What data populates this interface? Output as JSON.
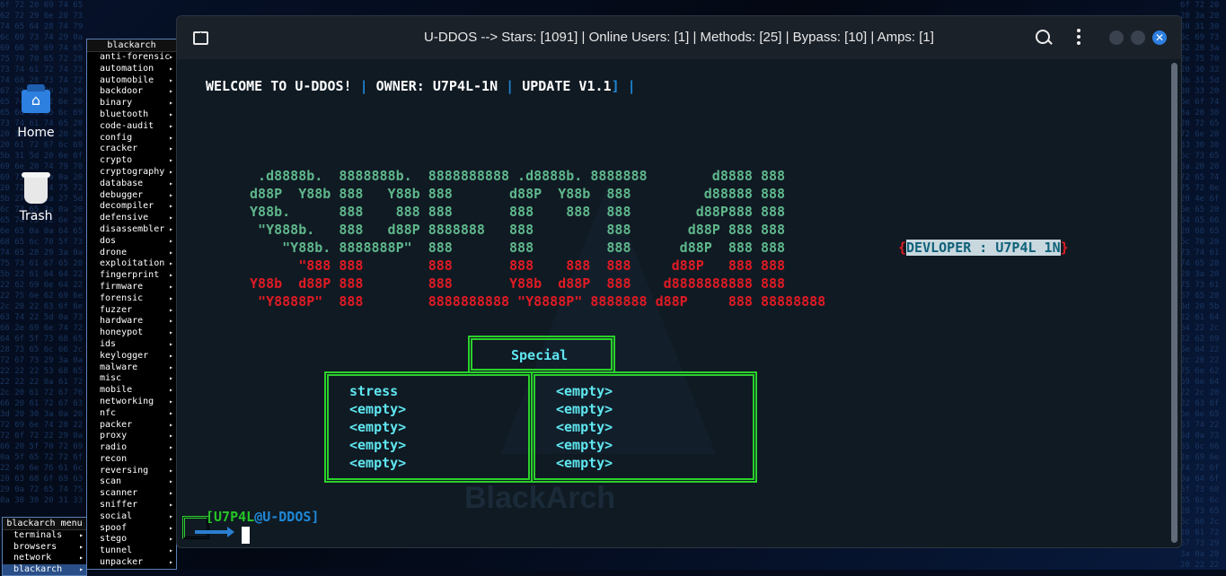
{
  "desktop": {
    "icons": [
      {
        "label": "Home",
        "icon": "home-folder-icon"
      },
      {
        "label": "Trash",
        "icon": "trash-icon"
      }
    ]
  },
  "blackarch_menu": {
    "title": "blackarch",
    "items": [
      "anti-forensic",
      "automation",
      "automobile",
      "backdoor",
      "binary",
      "bluetooth",
      "code-audit",
      "config",
      "cracker",
      "crypto",
      "cryptography",
      "database",
      "debugger",
      "decompiler",
      "defensive",
      "disassembler",
      "dos",
      "drone",
      "exploitation",
      "fingerprint",
      "firmware",
      "forensic",
      "fuzzer",
      "hardware",
      "honeypot",
      "ids",
      "keylogger",
      "malware",
      "misc",
      "mobile",
      "networking",
      "nfc",
      "packer",
      "proxy",
      "radio",
      "recon",
      "reversing",
      "scan",
      "scanner",
      "sniffer",
      "social",
      "spoof",
      "stego",
      "tunnel",
      "unpacker"
    ]
  },
  "root_menu": {
    "title": "blackarch menu",
    "items": [
      "terminals",
      "browsers",
      "network",
      "blackarch"
    ]
  },
  "window": {
    "title": "U-DDOS  --> Stars: [1091] | Online Users: [1] | Methods: [25] | Bypass: [10] | Amps: [1]"
  },
  "terminal": {
    "welcome": {
      "part1": "WELCOME TO U-DDOS!",
      "sep1": " | ",
      "part2": "OWNER: U7P4L-1N",
      "sep2": " | ",
      "part3": "UPDATE V1.1",
      "tail": "] |"
    },
    "banner": {
      "green": [
        "  .d8888b.  8888888b.  8888888888 .d8888b. 8888888        d8888 888",
        " d88P  Y88b 888   Y88b 888       d88P  Y88b  888         d88888 888",
        " Y88b.      888    888 888       888    888  888        d88P888 888",
        "  \"Y888b.   888   d88P 8888888   888         888       d88P 888 888",
        "     \"Y88b. 8888888P\"  888       888         888      d88P  888 888"
      ],
      "red": [
        "       \"888 888        888       888    888  888     d88P   888 888",
        " Y88b  d88P 888        888       Y88b  d88P  888    d8888888888 888",
        "  \"Y8888P\"  888        8888888888 \"Y8888P\" 8888888 d88P     888 88888888"
      ]
    },
    "developer": {
      "open": "{",
      "text": "DEVLOPER : U7P4L 1N",
      "close": "}"
    },
    "special_header": "Special",
    "left_methods": [
      "stress",
      "<empty>",
      "<empty>",
      "<empty>",
      "<empty>"
    ],
    "right_methods": [
      "<empty>",
      "<empty>",
      "<empty>",
      "<empty>",
      "<empty>"
    ],
    "prompt": {
      "open": "[",
      "user": "U7P4L",
      "at": "@",
      "host": "U-DDOS",
      "close": "]"
    },
    "watermark": "BlackArch"
  },
  "colors": {
    "banner_green": "#5fb88c",
    "banner_red": "#e01b24",
    "accent_cyan": "#5fe7f0",
    "box_green": "#2bd02b",
    "close_button": "#2d7ee0"
  }
}
